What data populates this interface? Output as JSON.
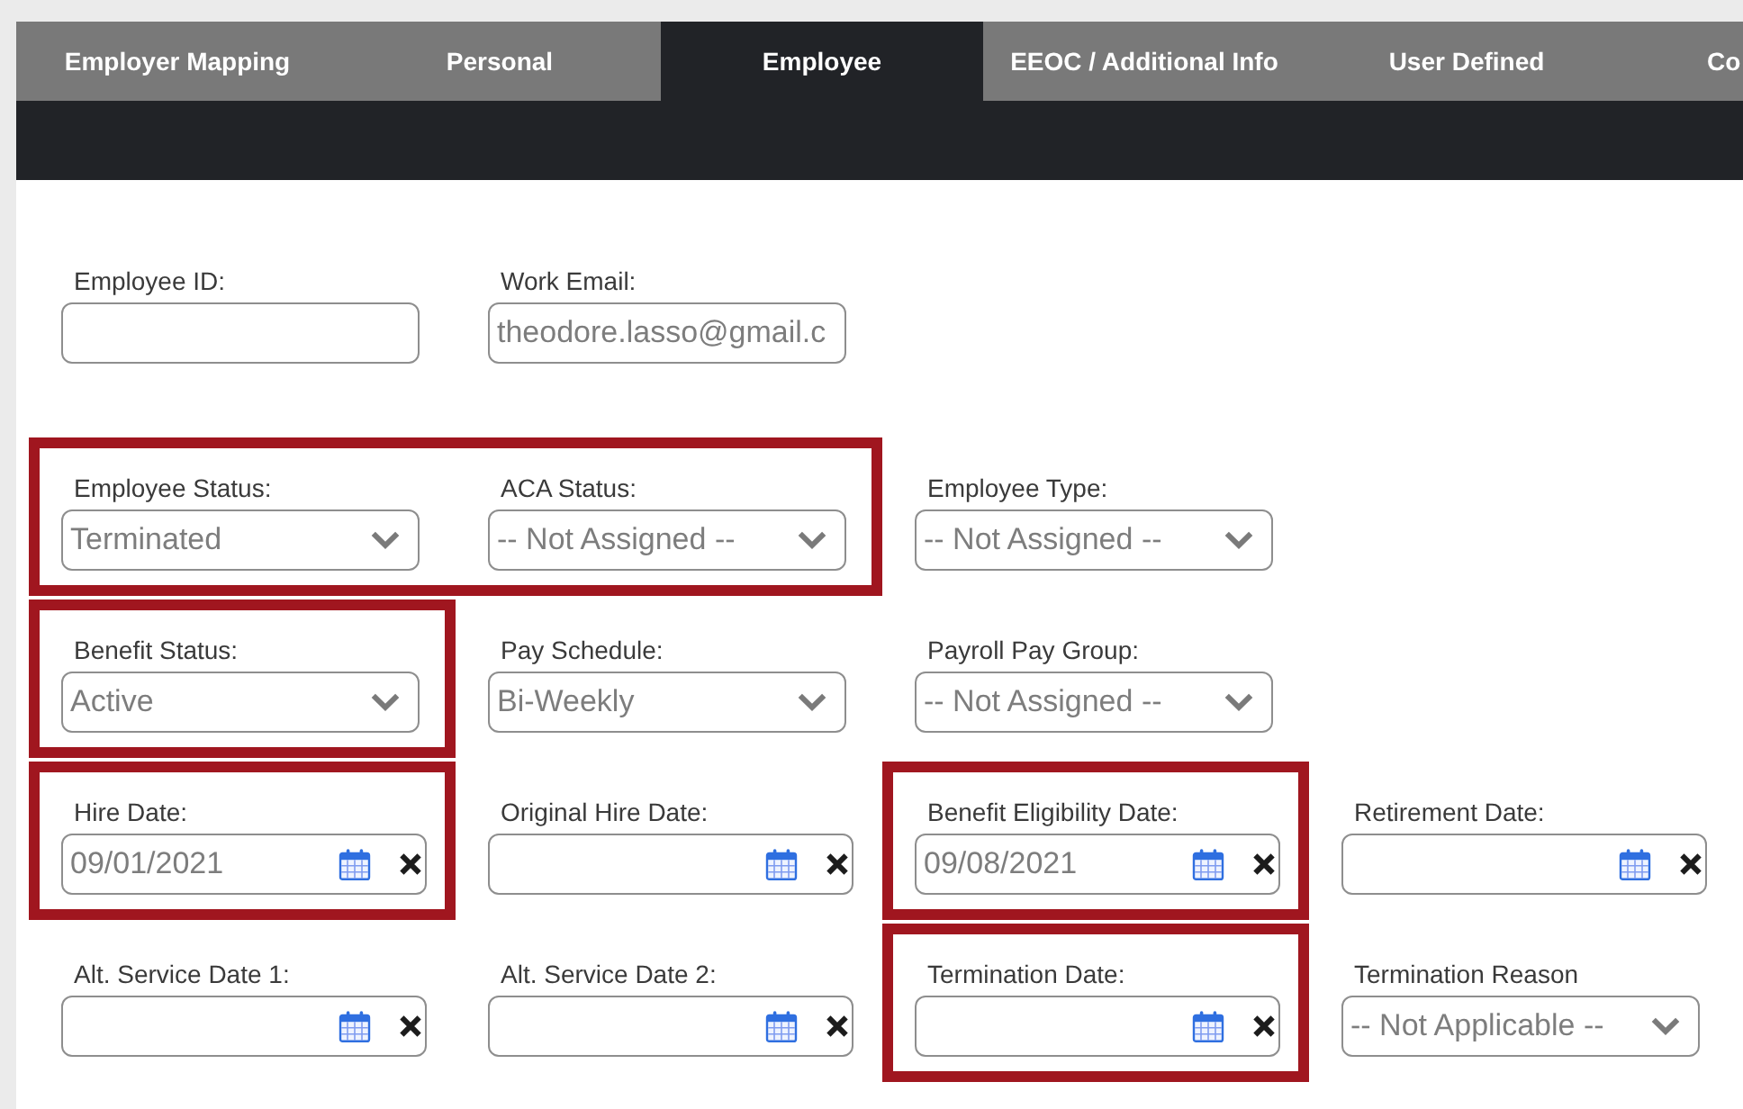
{
  "tabs": [
    {
      "label": "Employer Mapping",
      "selected": false
    },
    {
      "label": "Personal",
      "selected": false
    },
    {
      "label": "Employee",
      "selected": true
    },
    {
      "label": "EEOC / Additional Info",
      "selected": false
    },
    {
      "label": "User Defined",
      "selected": false
    },
    {
      "label": "Co",
      "selected": false
    }
  ],
  "form": {
    "rows": [
      {
        "groups": [
          {
            "highlighted": false,
            "fields": [
              {
                "kind": "text",
                "label": "Employee ID:"
              },
              {
                "kind": "text",
                "label": "Work Email:",
                "value": "theodore.lasso@gmail.c"
              }
            ]
          }
        ]
      },
      {
        "groups": [
          {
            "highlighted": true,
            "fields": [
              {
                "kind": "select",
                "label": "Employee Status:",
                "value": "Terminated"
              },
              {
                "kind": "select",
                "label": "ACA Status:",
                "value": "-- Not Assigned --"
              }
            ]
          },
          {
            "highlighted": false,
            "fields": [
              {
                "kind": "select",
                "label": "Employee Type:",
                "value": "-- Not Assigned --"
              }
            ]
          }
        ]
      },
      {
        "groups": [
          {
            "highlighted": true,
            "fields": [
              {
                "kind": "select",
                "label": "Benefit Status:",
                "value": "Active"
              }
            ]
          },
          {
            "highlighted": false,
            "fields": [
              {
                "kind": "select",
                "label": "Pay Schedule:",
                "value": "Bi-Weekly"
              },
              {
                "kind": "select",
                "label": "Payroll Pay Group:",
                "value": "-- Not Assigned --"
              }
            ]
          }
        ]
      },
      {
        "groups": [
          {
            "highlighted": true,
            "fields": [
              {
                "kind": "date",
                "label": "Hire Date:",
                "value": "09/01/2021"
              }
            ]
          },
          {
            "highlighted": false,
            "fields": [
              {
                "kind": "date",
                "label": "Original Hire Date:"
              }
            ]
          },
          {
            "highlighted": true,
            "fields": [
              {
                "kind": "date",
                "label": "Benefit Eligibility Date:",
                "value": "09/08/2021"
              }
            ]
          },
          {
            "highlighted": false,
            "fields": [
              {
                "kind": "date",
                "label": "Retirement Date:"
              }
            ]
          }
        ]
      },
      {
        "groups": [
          {
            "highlighted": false,
            "fields": [
              {
                "kind": "date",
                "label": "Alt. Service Date 1:"
              },
              {
                "kind": "date",
                "label": "Alt. Service Date 2:"
              }
            ]
          },
          {
            "highlighted": true,
            "fields": [
              {
                "kind": "date",
                "label": "Termination Date:"
              }
            ]
          },
          {
            "highlighted": false,
            "fields": [
              {
                "kind": "select",
                "label": "Termination Reason",
                "value": "-- Not Applicable --"
              }
            ]
          }
        ]
      }
    ]
  }
}
